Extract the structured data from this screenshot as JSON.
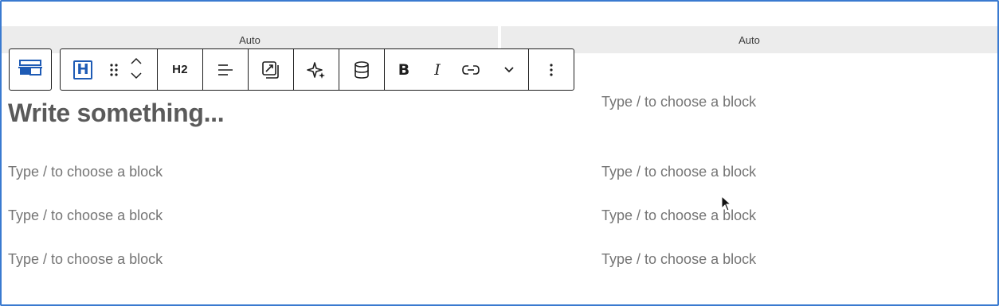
{
  "columns": [
    {
      "header": "Auto"
    },
    {
      "header": "Auto"
    }
  ],
  "toolbar": {
    "parent_icon": "columns-block-icon",
    "block_icon": "heading-H-icon",
    "block_icon_label": "H",
    "heading_level": "H2",
    "bold_label": "B",
    "italic_label": "I"
  },
  "left_column": {
    "heading_placeholder": "Write something...",
    "paragraphs": [
      "Type / to choose a block",
      "Type / to choose a block",
      "Type / to choose a block"
    ]
  },
  "right_column": {
    "paragraphs": [
      "Type / to choose a block",
      "Type / to choose a block",
      "Type / to choose a block",
      "Type / to choose a block"
    ]
  },
  "colors": {
    "selection_border": "#3a7ad0",
    "header_bg": "#ececec",
    "accent_blue": "#1e5bb5",
    "placeholder": "#757575"
  }
}
